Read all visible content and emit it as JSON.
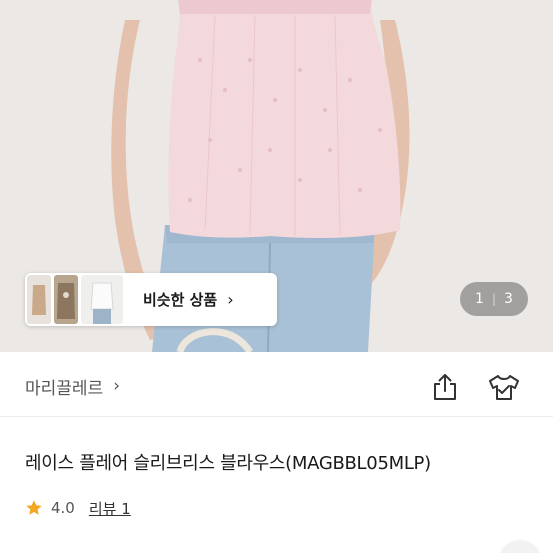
{
  "gallery": {
    "current_page": "1",
    "total_pages": "3",
    "similar_label": "비슷한 상품",
    "similar_chevron": "›"
  },
  "shop": {
    "name": "마리끌레르",
    "chevron": "›",
    "share_icon": "share-icon",
    "fit_icon": "clothing-icon"
  },
  "product": {
    "title": "레이스 플레어 슬리브리스 블라우스(MAGBBL05MLP)",
    "rating": "4.0",
    "review_label": "리뷰 1"
  },
  "colors": {
    "star": "#f5a623",
    "blouse": "#f3d9dc",
    "denim": "#a9c1d6"
  }
}
